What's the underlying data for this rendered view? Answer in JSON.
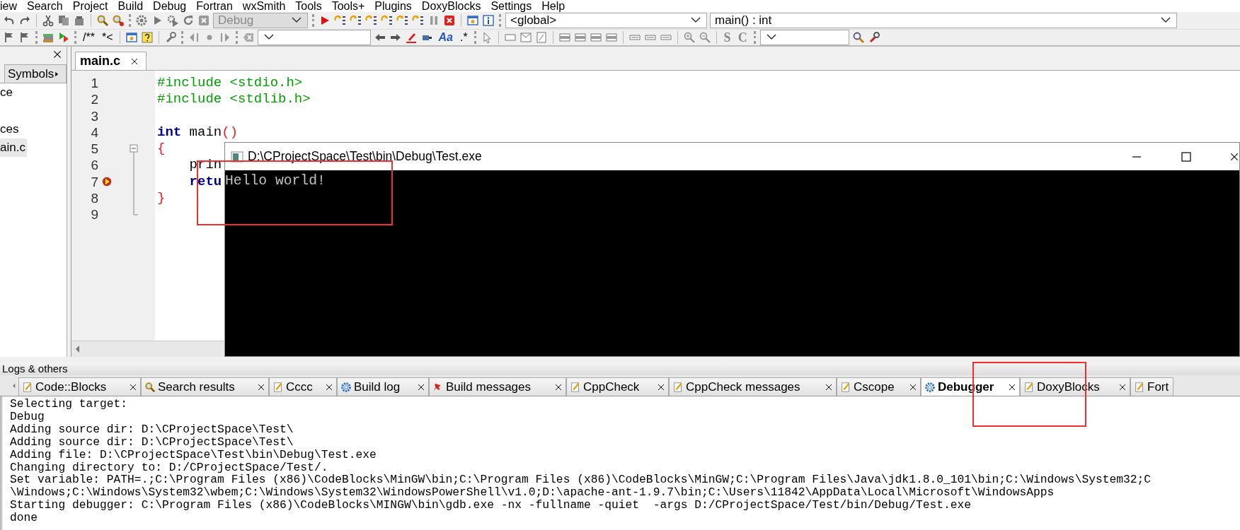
{
  "menu": [
    "iew",
    "Search",
    "Project",
    "Build",
    "Debug",
    "Fortran",
    "wxSmith",
    "Tools",
    "Tools+",
    "Plugins",
    "DoxyBlocks",
    "Settings",
    "Help"
  ],
  "toolbar": {
    "build_target": {
      "value": "Debug",
      "disabled": true
    },
    "scope": "<global>",
    "symbol": "main() : int",
    "comment_buttons": [
      "/**",
      "*<"
    ],
    "regex_buttons": [
      "Aa",
      ".*"
    ],
    "style_buttons": [
      "S",
      "C"
    ]
  },
  "left_panel": {
    "tabs": [
      {
        "label": "Symbols",
        "selected": false
      }
    ],
    "tree": [
      {
        "label": "ce",
        "selected": false
      },
      {
        "label": "ces",
        "selected": false
      },
      {
        "label": "ain.c",
        "selected": true
      }
    ]
  },
  "editor": {
    "tabs": [
      {
        "label": "main.c",
        "selected": true
      }
    ],
    "lines": [
      {
        "number": "1",
        "current": false,
        "fold_start": false,
        "tokens": [
          {
            "text": "#include <stdio.h>",
            "kind": "preproc"
          }
        ]
      },
      {
        "number": "2",
        "current": false,
        "fold_start": false,
        "tokens": [
          {
            "text": "#include <stdlib.h>",
            "kind": "preproc"
          }
        ]
      },
      {
        "number": "3",
        "current": false,
        "fold_start": false
      },
      {
        "number": "4",
        "current": false,
        "fold_start": false,
        "tokens": [
          {
            "text": "int",
            "kind": "keyword"
          },
          {
            "text": " main",
            "kind": "plain"
          },
          {
            "text": "()",
            "kind": "brace"
          }
        ]
      },
      {
        "number": "5",
        "current": false,
        "fold_start": true,
        "tokens": [
          {
            "text": "{",
            "kind": "brace"
          }
        ]
      },
      {
        "number": "6",
        "current": false,
        "fold_start": false,
        "tokens": [
          {
            "text": "    prin",
            "kind": "plain"
          }
        ]
      },
      {
        "number": "7",
        "current": true,
        "fold_start": false,
        "tokens": [
          {
            "text": "    retu",
            "kind": "keyword"
          }
        ]
      },
      {
        "number": "8",
        "current": false,
        "fold_start": false,
        "tokens": [
          {
            "text": "}",
            "kind": "brace"
          }
        ]
      },
      {
        "number": "9",
        "current": false,
        "fold_start": false
      }
    ]
  },
  "console": {
    "title": "D:\\CProjectSpace\\Test\\bin\\Debug\\Test.exe",
    "output": [
      "Hello world!"
    ]
  },
  "logs": {
    "title": "Logs & others",
    "tabs": [
      {
        "label": "Code::Blocks",
        "kind": "note",
        "selected": false
      },
      {
        "label": "Search results",
        "kind": "search",
        "selected": false
      },
      {
        "label": "Cccc",
        "kind": "note",
        "selected": false
      },
      {
        "label": "Build log",
        "kind": "gear",
        "selected": false
      },
      {
        "label": "Build messages",
        "kind": "pin",
        "selected": false
      },
      {
        "label": "CppCheck",
        "kind": "note",
        "selected": false
      },
      {
        "label": "CppCheck messages",
        "kind": "note",
        "selected": false
      },
      {
        "label": "Cscope",
        "kind": "note",
        "selected": false
      },
      {
        "label": "Debugger",
        "kind": "gear",
        "selected": true
      },
      {
        "label": "DoxyBlocks",
        "kind": "note",
        "selected": false
      },
      {
        "label": "Fort",
        "kind": "note",
        "selected": false
      }
    ],
    "lines": [
      "Selecting target:",
      "Debug",
      "Adding source dir: D:\\CProjectSpace\\Test\\",
      "Adding source dir: D:\\CProjectSpace\\Test\\",
      "Adding file: D:\\CProjectSpace\\Test\\bin\\Debug\\Test.exe",
      "Changing directory to: D:/CProjectSpace/Test/.",
      "Set variable: PATH=.;C:\\Program Files (x86)\\CodeBlocks\\MinGW\\bin;C:\\Program Files (x86)\\CodeBlocks\\MinGW;C:\\Program Files\\Java\\jdk1.8.0_101\\bin;C:\\Windows\\System32;C",
      "\\Windows;C:\\Windows\\System32\\wbem;C:\\Windows\\System32\\WindowsPowerShell\\v1.0;D:\\apache-ant-1.9.7\\bin;C:\\Users\\11842\\AppData\\Local\\Microsoft\\WindowsApps",
      "Starting debugger: C:\\Program Files (x86)\\CodeBlocks\\MINGW\\bin\\gdb.exe -nx -fullname -quiet  -args D:/CProjectSpace/Test/bin/Debug/Test.exe",
      "done"
    ]
  },
  "annotations": [
    {
      "kind": "frame"
    },
    {
      "kind": "frame"
    }
  ]
}
